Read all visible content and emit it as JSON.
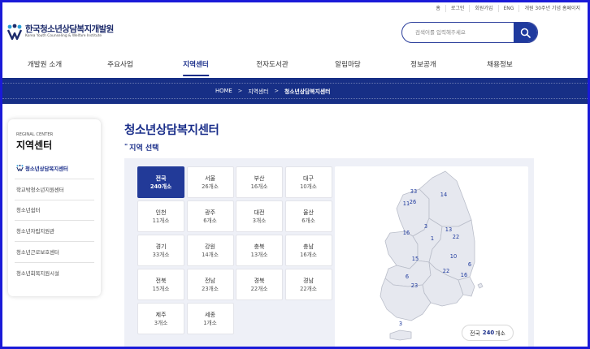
{
  "utility_links": [
    "홈",
    "로그인",
    "회원가입",
    "ENG",
    "개원 30주년 기념 홈페이지"
  ],
  "logo": {
    "name_kr": "한국청소년상담복지개발원",
    "name_en": "Korea Youth Counseling & Welfare Institute"
  },
  "search": {
    "placeholder": "검색어를 입력해주세요",
    "value": ""
  },
  "nav": [
    {
      "label": "개발원 소개",
      "active": false
    },
    {
      "label": "주요사업",
      "active": false
    },
    {
      "label": "지역센터",
      "active": true
    },
    {
      "label": "전자도서관",
      "active": false
    },
    {
      "label": "알림마당",
      "active": false
    },
    {
      "label": "정보공개",
      "active": false
    },
    {
      "label": "채용정보",
      "active": false
    }
  ],
  "breadcrumb": [
    "HOME",
    "지역센터",
    "청소년상담복지센터"
  ],
  "sidebar": {
    "eyebrow": "REGINAL CENTER",
    "title": "지역센터",
    "items": [
      {
        "label": "청소년상담복지센터",
        "active": true
      },
      {
        "label": "학교밖청소년지원센터",
        "active": false
      },
      {
        "label": "청소년쉼터",
        "active": false
      },
      {
        "label": "청소년자립지원관",
        "active": false
      },
      {
        "label": "청소년근로보호센터",
        "active": false
      },
      {
        "label": "청소년회복지원시설",
        "active": false
      }
    ]
  },
  "page_title": "청소년상담복지센터",
  "section_title": "지역 선택",
  "regions": [
    {
      "name": "전국",
      "count": "240개소",
      "active": true
    },
    {
      "name": "서울",
      "count": "26개소"
    },
    {
      "name": "부산",
      "count": "16개소"
    },
    {
      "name": "대구",
      "count": "10개소"
    },
    {
      "name": "인천",
      "count": "11개소"
    },
    {
      "name": "광주",
      "count": "6개소"
    },
    {
      "name": "대전",
      "count": "3개소"
    },
    {
      "name": "울산",
      "count": "6개소"
    },
    {
      "name": "경기",
      "count": "33개소"
    },
    {
      "name": "강원",
      "count": "14개소"
    },
    {
      "name": "충북",
      "count": "13개소"
    },
    {
      "name": "충남",
      "count": "16개소"
    },
    {
      "name": "전북",
      "count": "15개소"
    },
    {
      "name": "전남",
      "count": "23개소"
    },
    {
      "name": "경북",
      "count": "22개소"
    },
    {
      "name": "경남",
      "count": "22개소"
    },
    {
      "name": "제주",
      "count": "3개소"
    },
    {
      "name": "세종",
      "count": "1개소"
    }
  ],
  "map": {
    "labels": [
      "33",
      "14",
      "26",
      "11",
      "3",
      "13",
      "16",
      "1",
      "22",
      "15",
      "10",
      "6",
      "6",
      "22",
      "16",
      "23",
      "3"
    ],
    "total_label": "전국",
    "total_value": "240",
    "total_unit": "개소"
  },
  "colors": {
    "brand": "#1a2e8a",
    "banner": "#172f86",
    "active_cell": "#223a98",
    "map_land": "#e6e8ef",
    "map_label": "#1f3a9e"
  }
}
